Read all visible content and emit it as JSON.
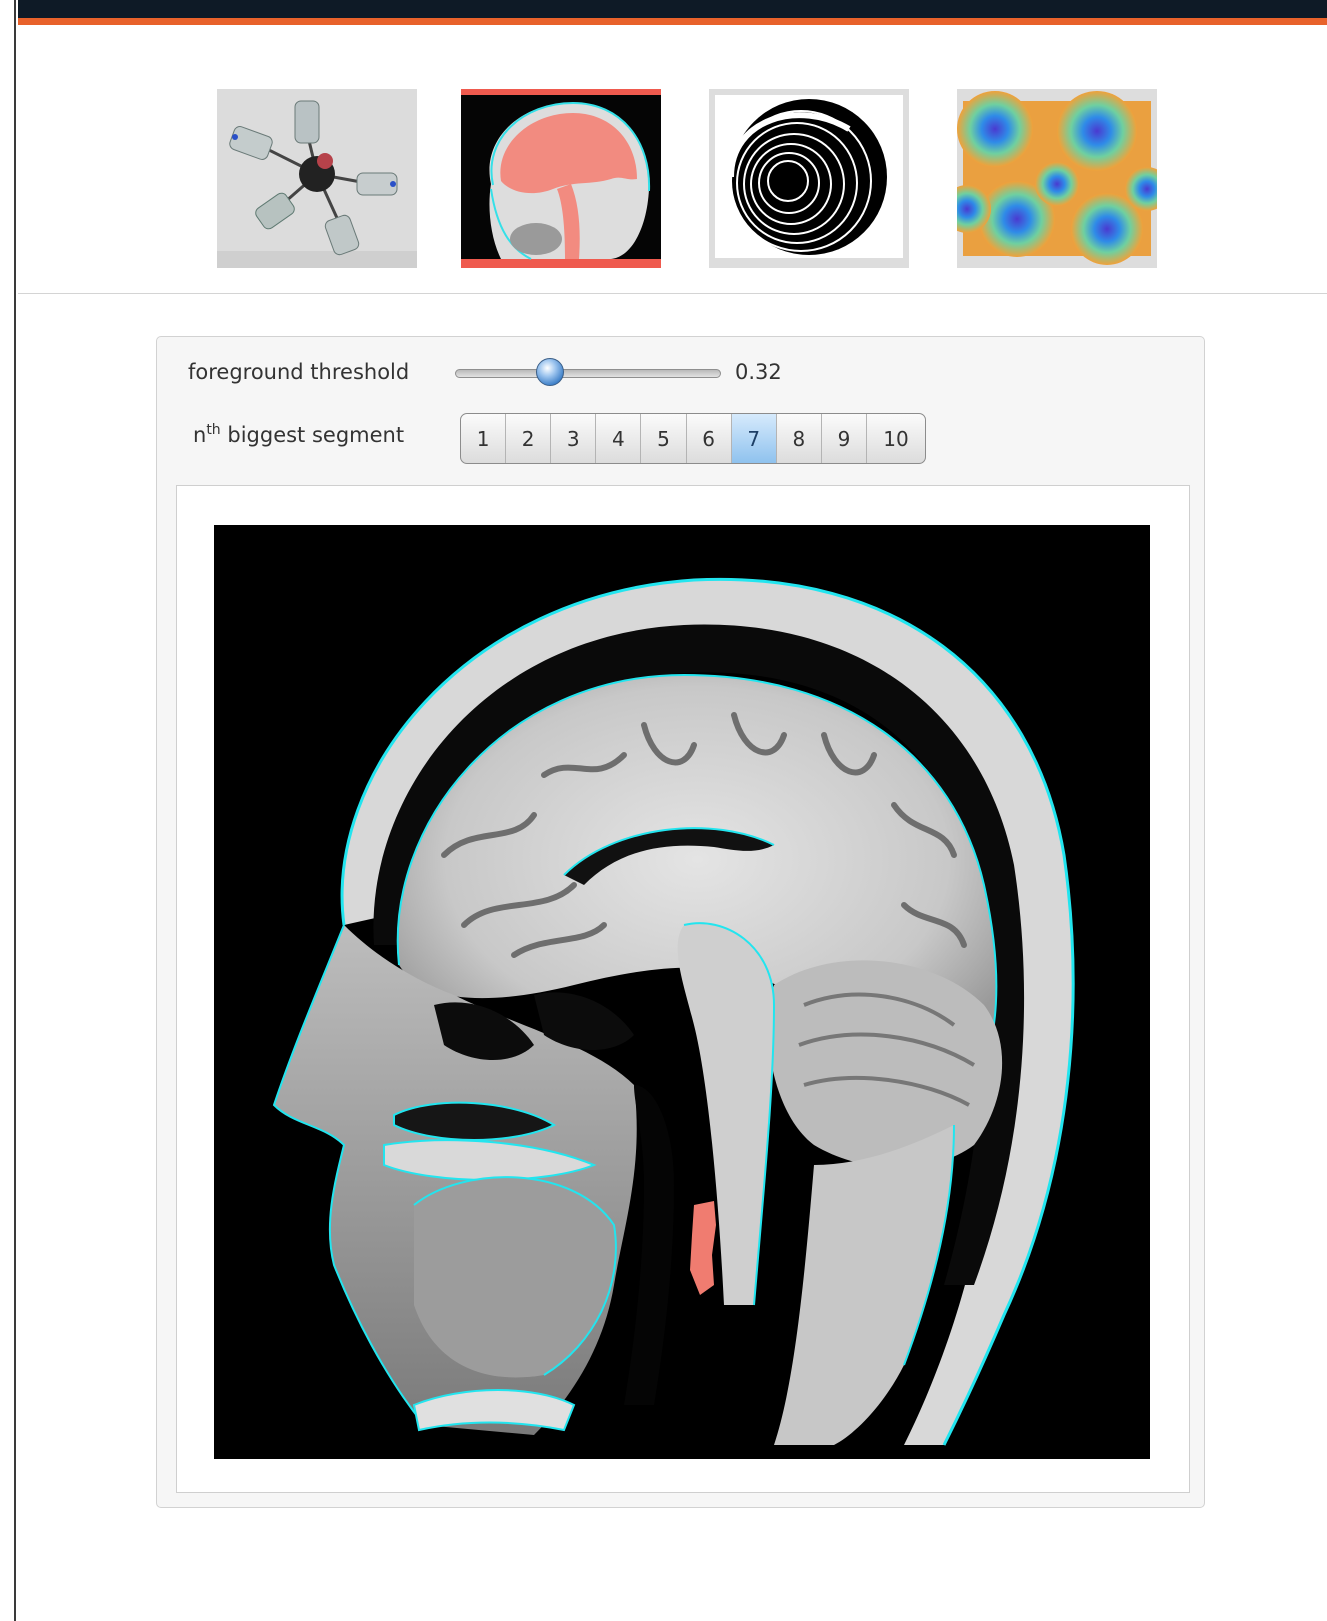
{
  "header": {
    "bar_color": "#0e1a26",
    "accent_color": "#e8622b"
  },
  "gallery": {
    "selected_index": 1,
    "thumbnails": [
      {
        "name": "mechanism-thumbnail"
      },
      {
        "name": "brain-segmentation-thumbnail"
      },
      {
        "name": "spiral-thumbnail"
      },
      {
        "name": "voronoi-thumbnail"
      }
    ]
  },
  "controls": {
    "threshold": {
      "label": "foreground threshold",
      "value": 0.32,
      "value_text": "0.32",
      "min": 0,
      "max": 1
    },
    "segment": {
      "label_base": "n",
      "label_sup": "th",
      "label_rest": "biggest segment",
      "options": [
        "1",
        "2",
        "3",
        "4",
        "5",
        "6",
        "7",
        "8",
        "9",
        "10"
      ],
      "selected": "7"
    }
  },
  "colors": {
    "outline": "#22e5ef",
    "segment_fill": "#f07c70",
    "selection": "#ef5a4e"
  }
}
